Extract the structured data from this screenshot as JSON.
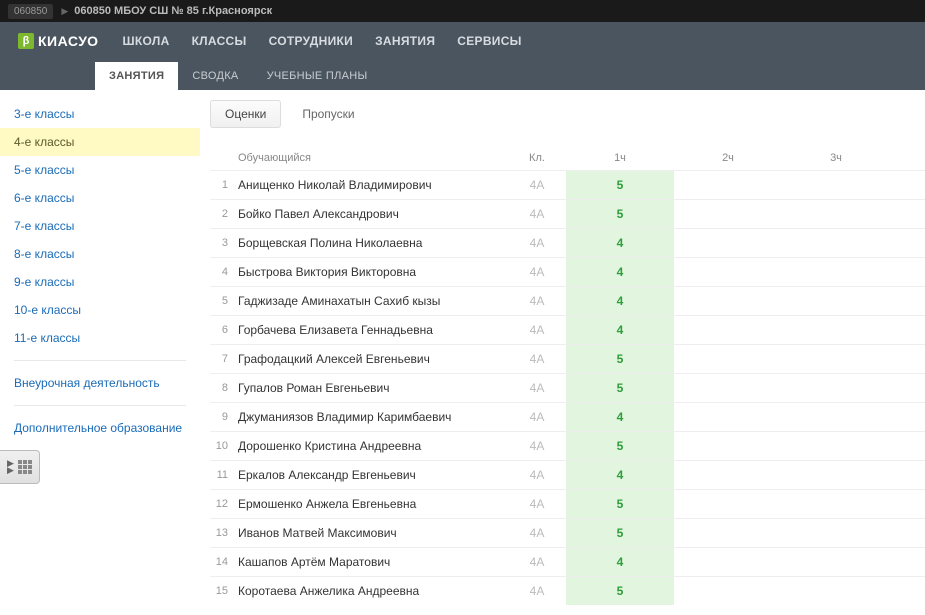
{
  "top": {
    "code": "060850",
    "school": "060850 МБОУ СШ № 85 г.Красноярск"
  },
  "logo_text": "КИАСУО",
  "nav": [
    "ШКОЛА",
    "КЛАССЫ",
    "СОТРУДНИКИ",
    "ЗАНЯТИЯ",
    "СЕРВИСЫ"
  ],
  "sub_tabs": [
    {
      "label": "ЗАНЯТИЯ",
      "active": true
    },
    {
      "label": "СВОДКА",
      "active": false
    },
    {
      "label": "УЧЕБНЫЕ ПЛАНЫ",
      "active": false
    }
  ],
  "sidebar": {
    "classes": [
      {
        "label": "3-е классы",
        "active": false
      },
      {
        "label": "4-е классы",
        "active": true
      },
      {
        "label": "5-е классы",
        "active": false
      },
      {
        "label": "6-е классы",
        "active": false
      },
      {
        "label": "7-е классы",
        "active": false
      },
      {
        "label": "8-е классы",
        "active": false
      },
      {
        "label": "9-е классы",
        "active": false
      },
      {
        "label": "10-е классы",
        "active": false
      },
      {
        "label": "11-е классы",
        "active": false
      }
    ],
    "extra": [
      "Внеурочная деятельность",
      "Дополнительное образование"
    ]
  },
  "small_tabs": [
    {
      "label": "Оценки",
      "active": true
    },
    {
      "label": "Пропуски",
      "active": false
    }
  ],
  "table": {
    "headers": {
      "name": "Обучающийся",
      "kl": "Кл.",
      "h1": "1ч",
      "h2": "2ч",
      "h3": "3ч"
    },
    "rows": [
      {
        "n": "1",
        "name": "Анищенко Николай Владимирович",
        "kl": "4А",
        "g1": "5"
      },
      {
        "n": "2",
        "name": "Бойко Павел Александрович",
        "kl": "4А",
        "g1": "5"
      },
      {
        "n": "3",
        "name": "Борщевская Полина Николаевна",
        "kl": "4А",
        "g1": "4"
      },
      {
        "n": "4",
        "name": "Быстрова Виктория Викторовна",
        "kl": "4А",
        "g1": "4"
      },
      {
        "n": "5",
        "name": "Гаджизаде Аминахатын Сахиб кызы",
        "kl": "4А",
        "g1": "4"
      },
      {
        "n": "6",
        "name": "Горбачева Елизавета Геннадьевна",
        "kl": "4А",
        "g1": "4"
      },
      {
        "n": "7",
        "name": "Графодацкий Алексей Евгеньевич",
        "kl": "4А",
        "g1": "5"
      },
      {
        "n": "8",
        "name": "Гупалов Роман Евгеньевич",
        "kl": "4А",
        "g1": "5"
      },
      {
        "n": "9",
        "name": "Джуманиязов Владимир Каримбаевич",
        "kl": "4А",
        "g1": "4"
      },
      {
        "n": "10",
        "name": "Дорошенко Кристина Андреевна",
        "kl": "4А",
        "g1": "5"
      },
      {
        "n": "11",
        "name": "Еркалов Александр Евгеньевич",
        "kl": "4А",
        "g1": "4"
      },
      {
        "n": "12",
        "name": "Ермошенко Анжела Евгеньевна",
        "kl": "4А",
        "g1": "5"
      },
      {
        "n": "13",
        "name": "Иванов Матвей Максимович",
        "kl": "4А",
        "g1": "5"
      },
      {
        "n": "14",
        "name": "Кашапов Артём Маратович",
        "kl": "4А",
        "g1": "4"
      },
      {
        "n": "15",
        "name": "Коротаева Анжелика Андреевна",
        "kl": "4А",
        "g1": "5"
      }
    ]
  }
}
